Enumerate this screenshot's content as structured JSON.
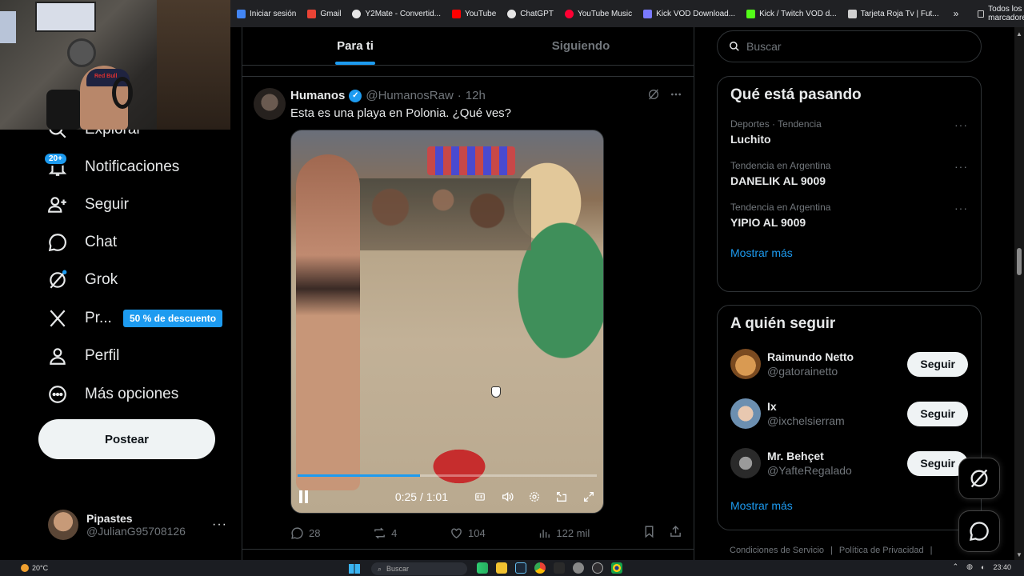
{
  "bookmarks": {
    "items": [
      {
        "label": "Iniciar sesión",
        "color": "#4285f4"
      },
      {
        "label": "Gmail",
        "color": "#ea4335"
      },
      {
        "label": "Y2Mate - Convertid...",
        "color": "#e6e6e6"
      },
      {
        "label": "YouTube",
        "color": "#ff0000"
      },
      {
        "label": "ChatGPT",
        "color": "#e6e6e6"
      },
      {
        "label": "YouTube Music",
        "color": "#ff0033"
      },
      {
        "label": "Kick VOD Download...",
        "color": "#7a7aff"
      },
      {
        "label": "Kick / Twitch VOD d...",
        "color": "#53fc18"
      },
      {
        "label": "Tarjeta Roja Tv | Fut...",
        "color": "#d0d0d0"
      }
    ],
    "more_label": "»",
    "all_label": "Todos los marcadores"
  },
  "webcam": {
    "cap_logo": "Red Bull"
  },
  "nav": {
    "explore_label": "Explorar",
    "notifications_label": "Notificaciones",
    "notifications_badge": "20+",
    "follow_label": "Seguir",
    "chat_label": "Chat",
    "grok_label": "Grok",
    "premium_label": "Pr...",
    "premium_promo": "50 % de descuento",
    "profile_label": "Perfil",
    "more_label": "Más opciones",
    "post_label": "Postear"
  },
  "account": {
    "name": "Pipastes",
    "handle": "@JulianG95708126",
    "more": "···"
  },
  "tabs": [
    {
      "label": "Para ti",
      "active": true
    },
    {
      "label": "Siguiendo",
      "active": false
    }
  ],
  "tweet": {
    "name": "Humanos",
    "verified_mark": "✓",
    "handle": "@HumanosRaw",
    "dot": "·",
    "time": "12h",
    "text": "Esta es una playa en Polonia. ¿Qué ves?",
    "video": {
      "time": "0:25 / 1:01",
      "progress": 0.41
    },
    "replies": "28",
    "reposts": "4",
    "likes": "104",
    "views": "122 mil"
  },
  "search": {
    "placeholder": "Buscar"
  },
  "trends": {
    "title": "Qué está pasando",
    "items": [
      {
        "context": "Deportes · Tendencia",
        "name": "Luchito"
      },
      {
        "context": "Tendencia en Argentina",
        "name": "DANELIK AL 9009"
      },
      {
        "context": "Tendencia en Argentina",
        "name": "YIPIO AL 9009"
      }
    ],
    "show_more": "Mostrar más"
  },
  "who_to_follow": {
    "title": "A quién seguir",
    "items": [
      {
        "name": "Raimundo Netto",
        "handle": "@gatorainetto",
        "button": "Seguir",
        "avatar_color": "#b8763e"
      },
      {
        "name": "Ix",
        "handle": "@ixchelsierram",
        "button": "Seguir",
        "avatar_color": "#6c8fb0"
      },
      {
        "name": "Mr. Behçet",
        "handle": "@YafteRegalado",
        "button": "Seguir",
        "avatar_color": "#3a3a3a"
      }
    ],
    "show_more": "Mostrar más"
  },
  "footer": {
    "terms": "Condiciones de Servicio",
    "privacy": "Política de Privacidad",
    "sep": "|"
  },
  "taskbar": {
    "weather": "20°C",
    "search": "Buscar",
    "time": "23:40"
  },
  "colors": {
    "accent": "#1d9bf0",
    "background": "#000000",
    "border": "#2f3336",
    "muted": "#71767b"
  }
}
